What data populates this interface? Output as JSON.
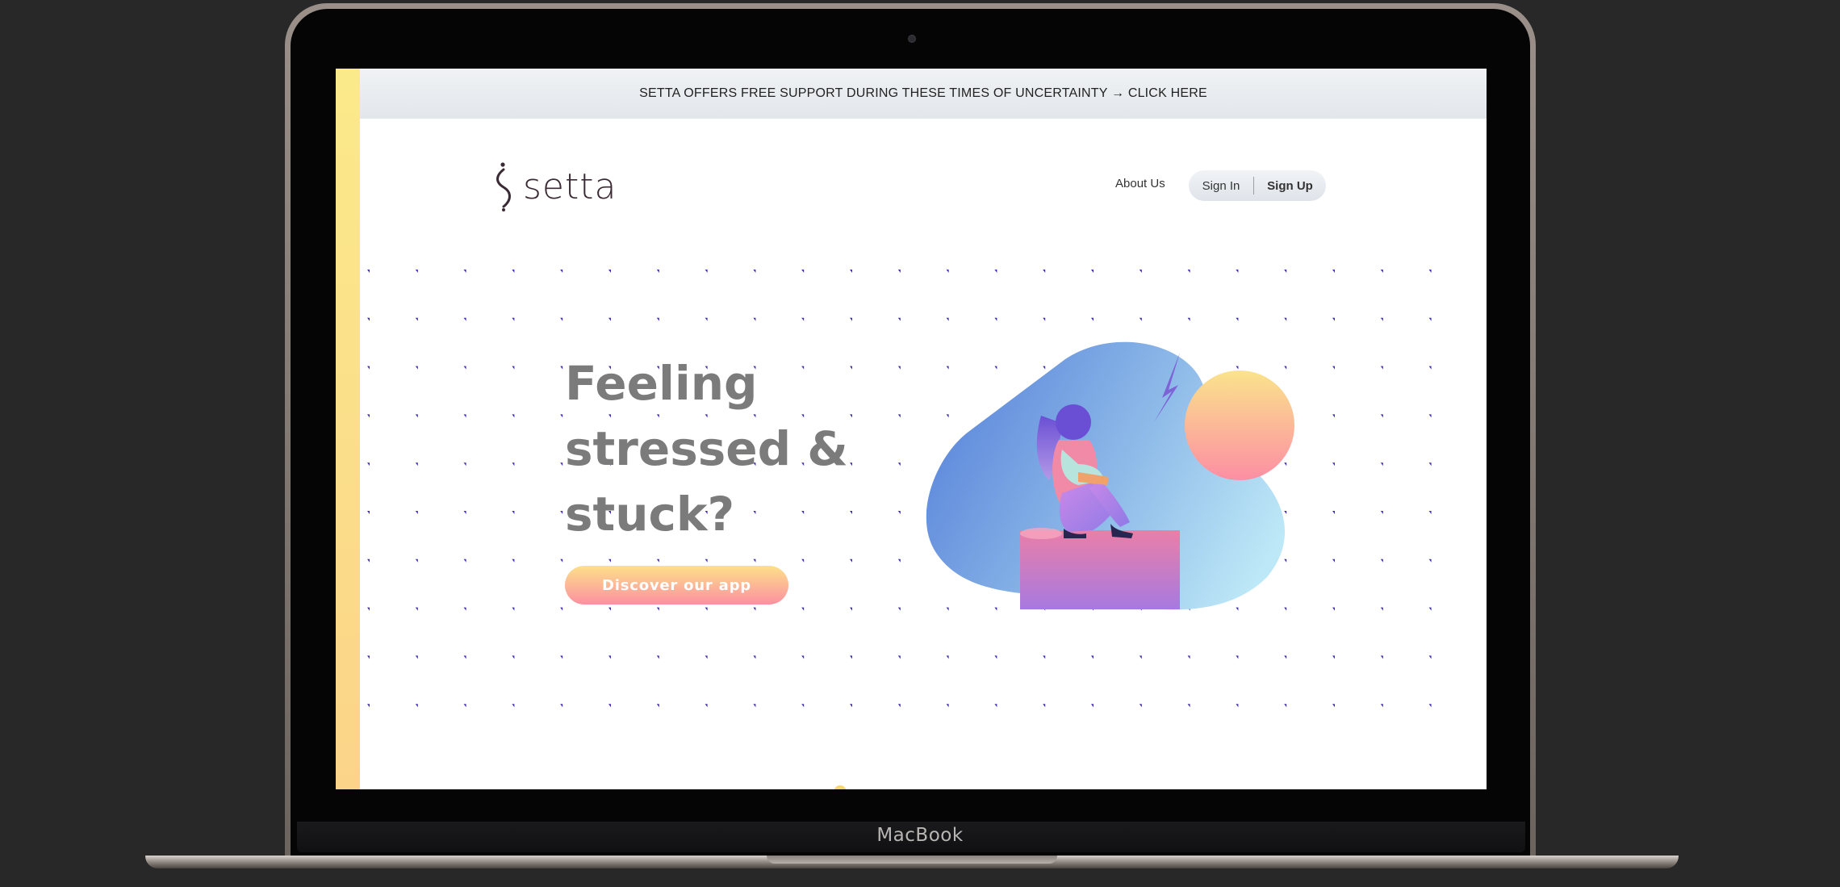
{
  "device": {
    "brand_label": "MacBook"
  },
  "banner": {
    "text": "SETTA OFFERS FREE SUPPORT DURING THESE TIMES OF UNCERTAINTY → CLICK HERE"
  },
  "header": {
    "logo_text": "setta",
    "nav": {
      "about": "About Us",
      "sign_in": "Sign In",
      "sign_up": "Sign Up"
    }
  },
  "hero": {
    "title": "Feeling\nstressed &\nstuck?",
    "cta_label": "Discover our app"
  },
  "colors": {
    "accent_yellow": "#fde08a",
    "accent_pink": "#fc90a0",
    "blob_blue": "#5b86db",
    "blob_light": "#bde8f7",
    "dot_color": "#3d2fb0",
    "title_gray": "#7b7b7b"
  },
  "icons": {
    "logo_mark": "s-curve-logo-icon",
    "illustration": "stressed-woman-illustration"
  }
}
